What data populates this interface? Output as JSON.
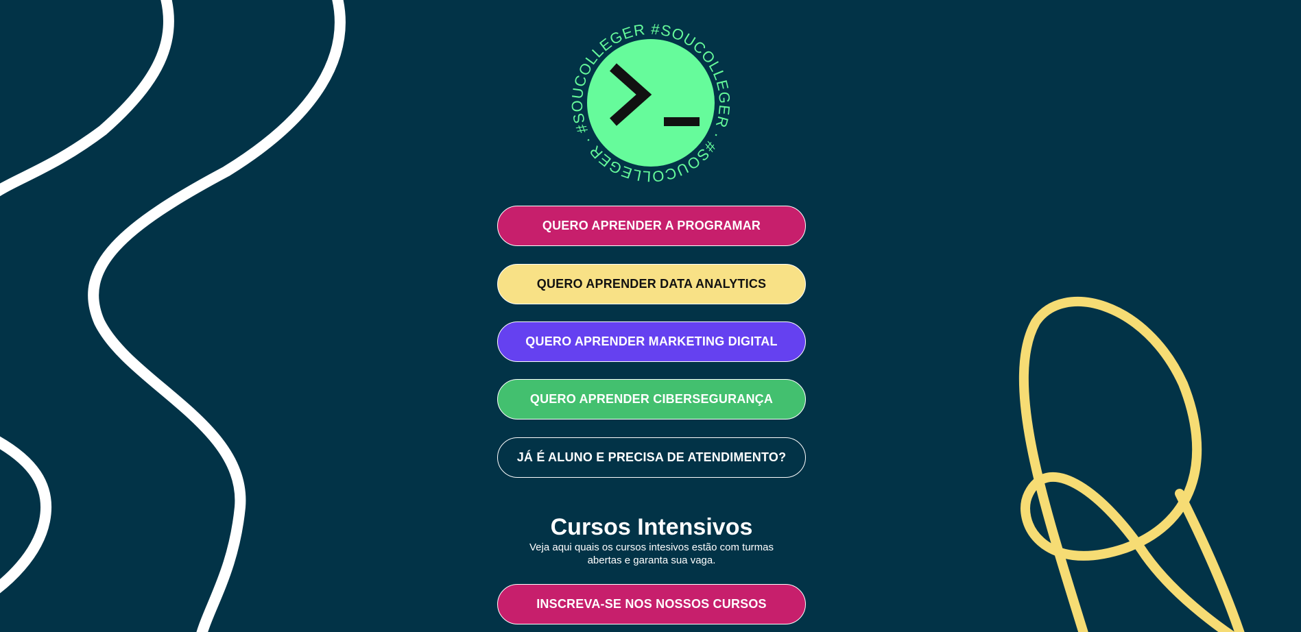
{
  "colors": {
    "background": "#023347",
    "logo_green": "#66FB9B",
    "pink": "#C71F6C",
    "yellow": "#F8E186",
    "purple": "#6541F0",
    "green": "#43C06F",
    "white": "#FFFFFF",
    "deco_yellow": "#F6DC74"
  },
  "logo": {
    "ring_text": "#SOUCOLLEGER · #SOUCOLLEGER · #SOUCOLLEGER · ",
    "icon": "terminal-prompt-icon"
  },
  "links": [
    {
      "label": "QUERO APRENDER A PROGRAMAR",
      "bg": "#C71F6C",
      "fg": "#FFFFFF"
    },
    {
      "label": "QUERO APRENDER DATA ANALYTICS",
      "bg": "#F8E186",
      "fg": "#111111"
    },
    {
      "label": "QUERO APRENDER MARKETING DIGITAL",
      "bg": "#6541F0",
      "fg": "#FFFFFF"
    },
    {
      "label": "QUERO APRENDER CIBERSEGURANÇA",
      "bg": "#43C06F",
      "fg": "#FFFFFF"
    },
    {
      "label": "JÁ É ALUNO E PRECISA DE ATENDIMENTO?",
      "bg": "transparent",
      "fg": "#FFFFFF"
    }
  ],
  "intensive": {
    "title": "Cursos Intensivos",
    "description": "Veja aqui quais os cursos intesivos estão com turmas abertas e garanta sua vaga.",
    "cta_label": "INSCREVA-SE NOS NOSSOS CURSOS"
  }
}
